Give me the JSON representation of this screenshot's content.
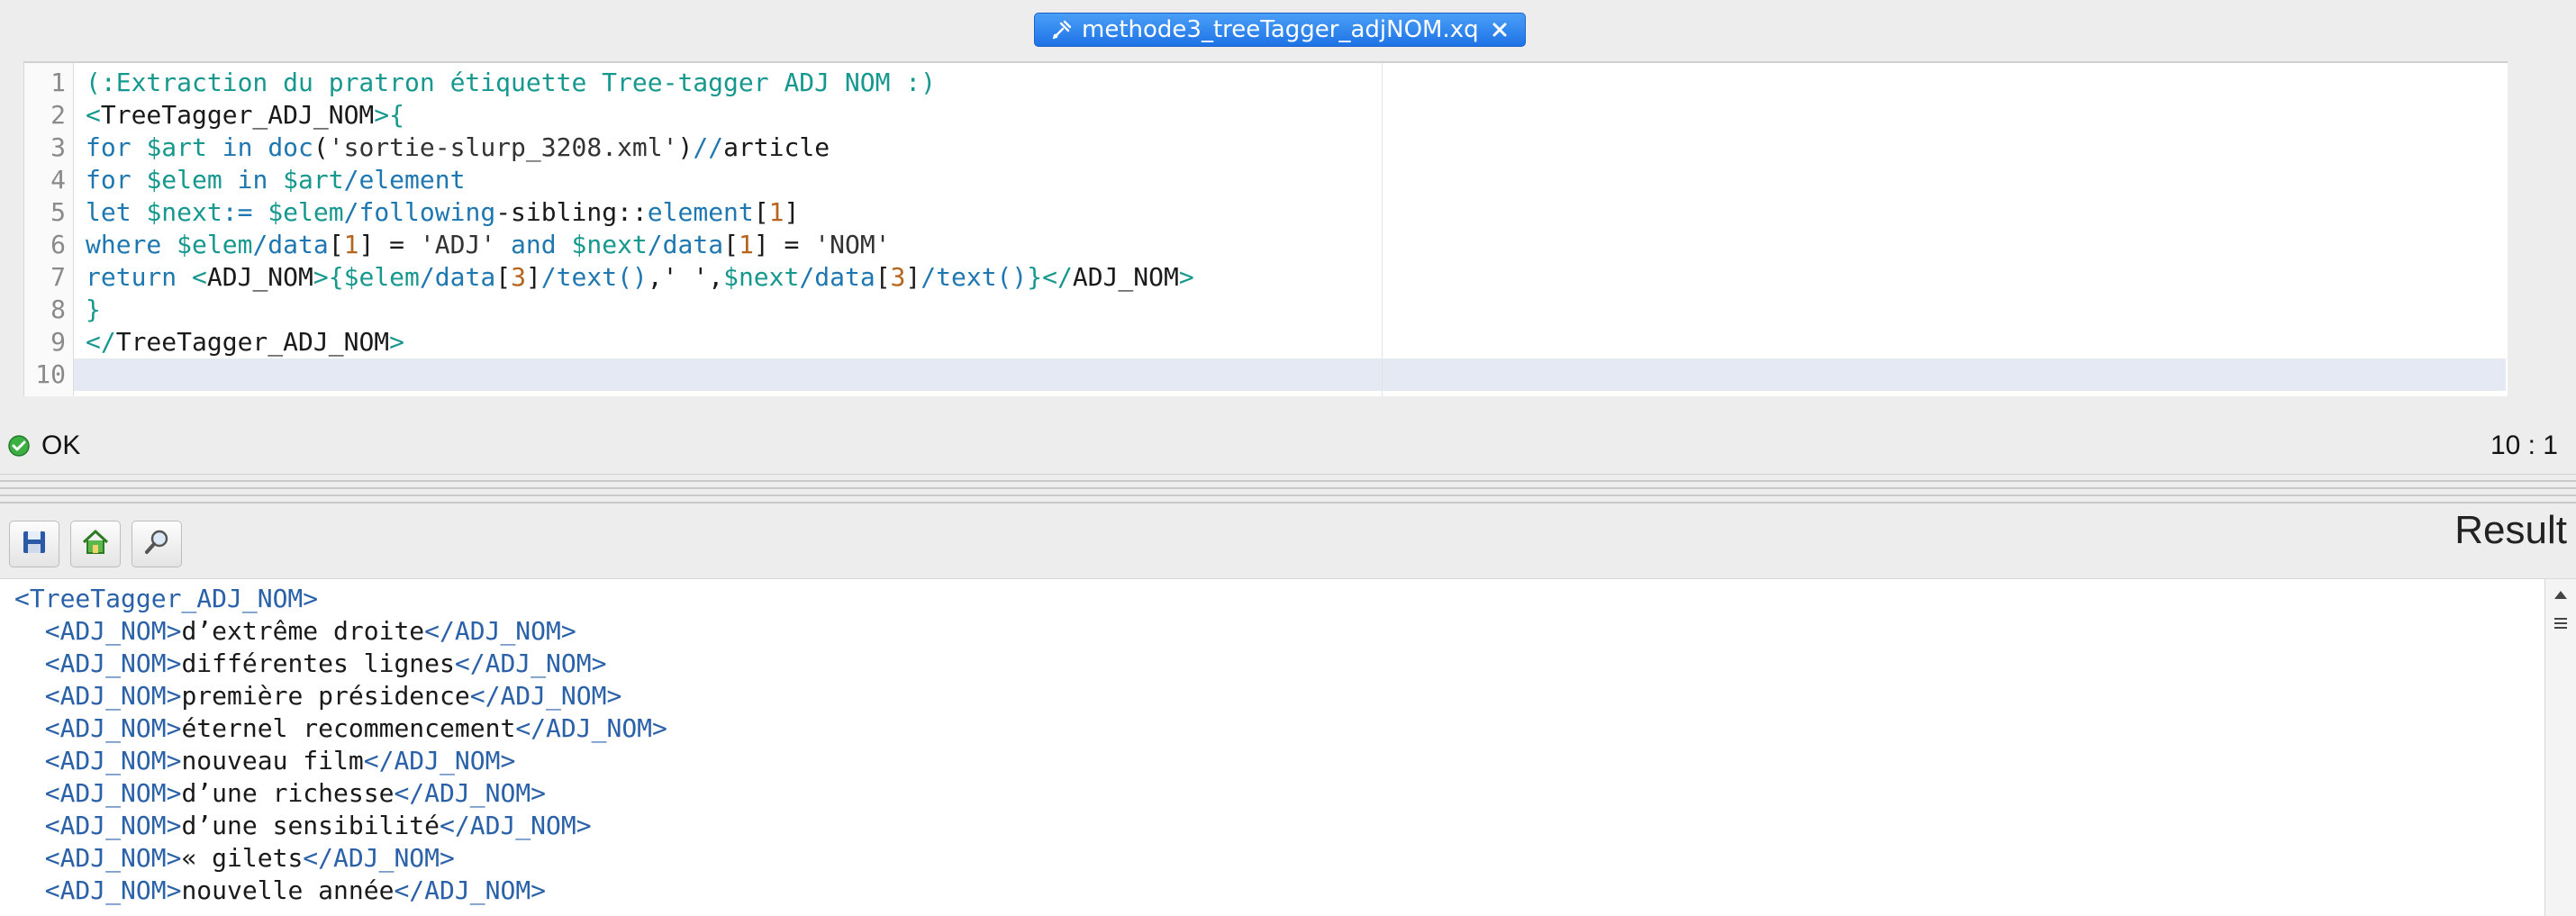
{
  "tab": {
    "title": "methode3_treeTagger_adjNOM.xq"
  },
  "editor": {
    "line_numbers": [
      "1",
      "2",
      "3",
      "4",
      "5",
      "6",
      "7",
      "8",
      "9",
      "10"
    ],
    "lines": [
      [
        {
          "t": "cm",
          "v": "(:Extraction du pratron étiquette Tree-tagger ADJ NOM :)"
        }
      ],
      [
        {
          "t": "tag",
          "v": "<"
        },
        {
          "t": "tagn",
          "v": "TreeTagger_ADJ_NOM"
        },
        {
          "t": "tag",
          "v": ">{"
        }
      ],
      [
        {
          "t": "kw",
          "v": "for "
        },
        {
          "t": "var",
          "v": "$art"
        },
        {
          "t": "kw",
          "v": " in "
        },
        {
          "t": "fn",
          "v": "doc"
        },
        {
          "t": "op",
          "v": "("
        },
        {
          "t": "str",
          "v": "'sortie-slurp_3208.xml'"
        },
        {
          "t": "op",
          "v": ")"
        },
        {
          "t": "kw",
          "v": "//"
        },
        {
          "t": "op",
          "v": "article"
        }
      ],
      [
        {
          "t": "kw",
          "v": "for "
        },
        {
          "t": "var",
          "v": "$elem"
        },
        {
          "t": "kw",
          "v": " in "
        },
        {
          "t": "var",
          "v": "$art"
        },
        {
          "t": "kw",
          "v": "/element"
        }
      ],
      [
        {
          "t": "kw",
          "v": "let "
        },
        {
          "t": "var",
          "v": "$next"
        },
        {
          "t": "kw",
          "v": ":= "
        },
        {
          "t": "var",
          "v": "$elem"
        },
        {
          "t": "kw",
          "v": "/following"
        },
        {
          "t": "op",
          "v": "-sibling::"
        },
        {
          "t": "kw",
          "v": "element"
        },
        {
          "t": "op",
          "v": "["
        },
        {
          "t": "num",
          "v": "1"
        },
        {
          "t": "op",
          "v": "]"
        }
      ],
      [
        {
          "t": "kw",
          "v": "where "
        },
        {
          "t": "var",
          "v": "$elem"
        },
        {
          "t": "kw",
          "v": "/data"
        },
        {
          "t": "op",
          "v": "["
        },
        {
          "t": "num",
          "v": "1"
        },
        {
          "t": "op",
          "v": "] = "
        },
        {
          "t": "str",
          "v": "'ADJ'"
        },
        {
          "t": "kw",
          "v": " and "
        },
        {
          "t": "var",
          "v": "$next"
        },
        {
          "t": "kw",
          "v": "/data"
        },
        {
          "t": "op",
          "v": "["
        },
        {
          "t": "num",
          "v": "1"
        },
        {
          "t": "op",
          "v": "] = "
        },
        {
          "t": "str",
          "v": "'NOM'"
        }
      ],
      [
        {
          "t": "kw",
          "v": "return "
        },
        {
          "t": "tag",
          "v": "<"
        },
        {
          "t": "tagn",
          "v": "ADJ_NOM"
        },
        {
          "t": "tag",
          "v": ">{"
        },
        {
          "t": "var",
          "v": "$elem"
        },
        {
          "t": "kw",
          "v": "/data"
        },
        {
          "t": "op",
          "v": "["
        },
        {
          "t": "num",
          "v": "3"
        },
        {
          "t": "op",
          "v": "]"
        },
        {
          "t": "kw",
          "v": "/text()"
        },
        {
          "t": "op",
          "v": ",' ',"
        },
        {
          "t": "var",
          "v": "$next"
        },
        {
          "t": "kw",
          "v": "/data"
        },
        {
          "t": "op",
          "v": "["
        },
        {
          "t": "num",
          "v": "3"
        },
        {
          "t": "op",
          "v": "]"
        },
        {
          "t": "kw",
          "v": "/text()"
        },
        {
          "t": "tag",
          "v": "}</"
        },
        {
          "t": "tagn",
          "v": "ADJ_NOM"
        },
        {
          "t": "tag",
          "v": ">"
        }
      ],
      [
        {
          "t": "tag",
          "v": "}"
        }
      ],
      [
        {
          "t": "tag",
          "v": "</"
        },
        {
          "t": "tagn",
          "v": "TreeTagger_ADJ_NOM"
        },
        {
          "t": "tag",
          "v": ">"
        }
      ],
      []
    ]
  },
  "status": {
    "text": "OK",
    "cursor": "10 : 1"
  },
  "result": {
    "title": "Result",
    "root_open": "<TreeTagger_ADJ_NOM>",
    "open_tag": "<ADJ_NOM>",
    "close_tag": "</ADJ_NOM>",
    "items": [
      "d’extrême droite",
      "différentes lignes",
      "première présidence",
      "éternel recommencement",
      "nouveau film",
      "d’une richesse",
      "d’une sensibilité",
      "« gilets",
      "nouvelle année"
    ]
  },
  "icons": {
    "tab": "xquery-file-icon",
    "close": "close-icon",
    "status": "ok-check-icon",
    "save": "save-icon",
    "home": "home-icon",
    "search": "search-icon"
  },
  "colors": {
    "tab": "#2a7de8",
    "keyword": "#1e77b0",
    "comment": "#17988e",
    "number": "#b5651d"
  }
}
